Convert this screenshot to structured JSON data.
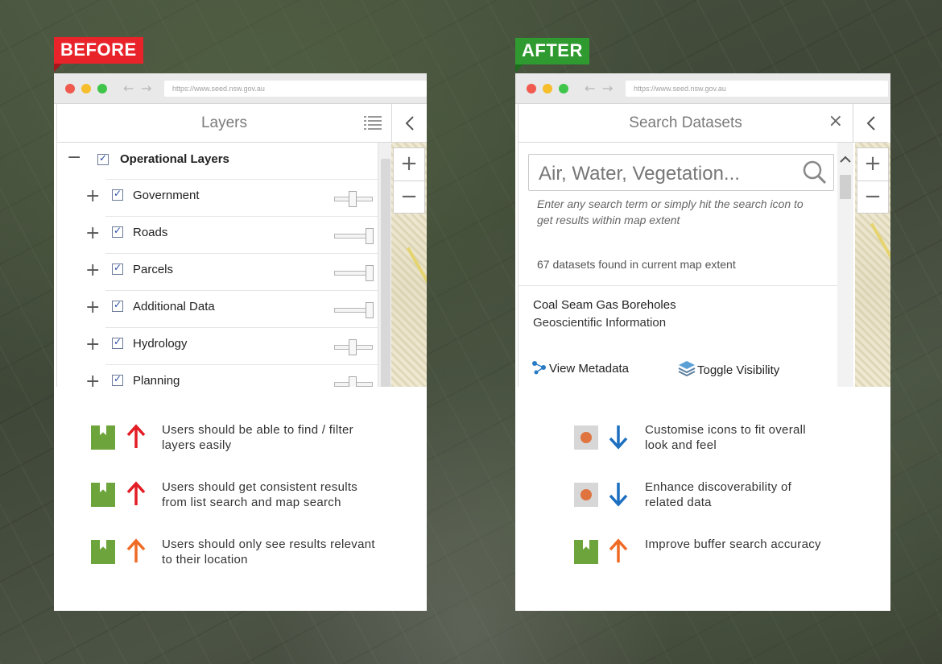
{
  "before": {
    "tag": "BEFORE",
    "browser": {
      "url": "https://www.seed.nsw.gov.au"
    },
    "panel": {
      "title": "Layers",
      "root": {
        "label": "Operational Layers",
        "checked": true
      },
      "layers": [
        {
          "label": "Government",
          "checked": true,
          "opacity": 0.45
        },
        {
          "label": "Roads",
          "checked": true,
          "opacity": 1.0
        },
        {
          "label": "Parcels",
          "checked": true,
          "opacity": 1.0
        },
        {
          "label": "Additional Data",
          "checked": true,
          "opacity": 1.0
        },
        {
          "label": "Hydrology",
          "checked": true,
          "opacity": 0.45
        },
        {
          "label": "Planning",
          "checked": true,
          "opacity": 0.45
        }
      ]
    },
    "notes": [
      {
        "text1": "Users should be able to find / filter",
        "text2": "layers easily",
        "badge": "bookmark-icon",
        "arrow": "up",
        "arrow_color": "#e31d25"
      },
      {
        "text1": "Users should get consistent results",
        "text2": "from list search and map search",
        "badge": "bookmark-icon",
        "arrow": "up",
        "arrow_color": "#e31d25"
      },
      {
        "text1": "Users should only see results relevant",
        "text2": "to their location",
        "badge": "bookmark-icon",
        "arrow": "up",
        "arrow_color": "#ef6a25"
      }
    ]
  },
  "after": {
    "tag": "AFTER",
    "browser": {
      "url": "https://www.seed.nsw.gov.au"
    },
    "panel": {
      "title": "Search Datasets",
      "search_placeholder": "Air, Water, Vegetation...",
      "hint1": "Enter any search term or simply hit the search icon to",
      "hint2": "get results within map extent",
      "count_text": "67 datasets found in current map extent",
      "result": {
        "title": "Coal Seam Gas Boreholes",
        "category": "Geoscientific Information",
        "action_metadata": "View Metadata",
        "action_visibility": "Toggle Visibility"
      }
    },
    "notes": [
      {
        "text1": "Customise icons to fit overall",
        "text2": "look and feel",
        "badge": "dot-icon",
        "arrow": "down",
        "arrow_color": "#1d6fc0"
      },
      {
        "text1": "Enhance discoverability of",
        "text2": "related data",
        "badge": "dot-icon",
        "arrow": "down",
        "arrow_color": "#1d6fc0"
      },
      {
        "text1": "Improve buffer search accuracy",
        "text2": "",
        "badge": "bookmark-icon",
        "arrow": "up",
        "arrow_color": "#ef6a25"
      }
    ]
  },
  "colors": {
    "before_tag": "#e8232a",
    "after_tag": "#2f9a2f",
    "bookmark_badge": "#6da43b",
    "dot_badge": "#e0743f"
  }
}
